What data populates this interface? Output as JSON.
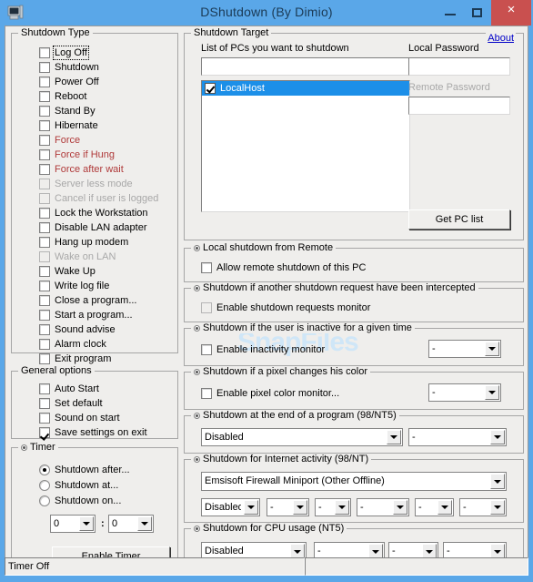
{
  "window": {
    "title": "DShutdown (By Dimio)",
    "icon": "computer-icon",
    "minimize_label": "–",
    "maximize_label": "□",
    "close_label": "×",
    "watermark": "SnapFiles"
  },
  "shutdown_type": {
    "caption": "Shutdown Type",
    "items": [
      {
        "label": "Log Off",
        "checked": false,
        "state": "focused"
      },
      {
        "label": "Shutdown",
        "checked": false,
        "state": "normal"
      },
      {
        "label": "Power Off",
        "checked": false,
        "state": "normal"
      },
      {
        "label": "Reboot",
        "checked": false,
        "state": "normal"
      },
      {
        "label": "Stand By",
        "checked": false,
        "state": "normal"
      },
      {
        "label": "Hibernate",
        "checked": false,
        "state": "normal"
      },
      {
        "label": "Force",
        "checked": false,
        "state": "red"
      },
      {
        "label": "Force if Hung",
        "checked": false,
        "state": "red"
      },
      {
        "label": "Force after wait",
        "checked": false,
        "state": "red"
      },
      {
        "label": "Server less mode",
        "checked": false,
        "state": "disabled"
      },
      {
        "label": "Cancel if user is logged",
        "checked": false,
        "state": "disabled"
      },
      {
        "label": "Lock the Workstation",
        "checked": false,
        "state": "normal"
      },
      {
        "label": "Disable LAN adapter",
        "checked": false,
        "state": "normal"
      },
      {
        "label": "Hang up modem",
        "checked": false,
        "state": "normal"
      },
      {
        "label": "Wake on LAN",
        "checked": false,
        "state": "disabled"
      },
      {
        "label": "Wake Up",
        "checked": false,
        "state": "normal"
      },
      {
        "label": "Write log file",
        "checked": false,
        "state": "normal"
      },
      {
        "label": "Close a program...",
        "checked": false,
        "state": "normal"
      },
      {
        "label": "Start a program...",
        "checked": false,
        "state": "normal"
      },
      {
        "label": "Sound advise",
        "checked": false,
        "state": "normal"
      },
      {
        "label": "Alarm clock",
        "checked": false,
        "state": "normal"
      },
      {
        "label": "Exit program",
        "checked": false,
        "state": "normal"
      }
    ]
  },
  "general_options": {
    "caption": "General options",
    "items": [
      {
        "label": "Auto Start",
        "checked": false
      },
      {
        "label": "Set default",
        "checked": false
      },
      {
        "label": "Sound on start",
        "checked": false
      },
      {
        "label": "Save settings on exit",
        "checked": true
      }
    ]
  },
  "timer": {
    "caption": "Timer",
    "radios": [
      {
        "label": "Shutdown after...",
        "selected": true
      },
      {
        "label": "Shutdown at...",
        "selected": false
      },
      {
        "label": "Shutdown on...",
        "selected": false
      }
    ],
    "hours_value": "0",
    "separator": ":",
    "minutes_value": "0",
    "button_label": "Enable Timer"
  },
  "shutdown_target": {
    "caption": "Shutdown Target",
    "about_label": "About",
    "pc_list_label": "List of PCs you want to shutdown",
    "pc_input_value": "",
    "pc_list": [
      {
        "label": "LocalHost",
        "checked": true,
        "selected": true
      }
    ],
    "local_password_label": "Local Password",
    "local_password_value": "",
    "remote_password_label": "Remote Password",
    "remote_password_value": "",
    "get_pc_list_label": "Get PC list"
  },
  "local_remote": {
    "caption": "Local shutdown from Remote",
    "checkbox_label": "Allow remote shutdown of this PC",
    "checked": false
  },
  "intercept": {
    "caption": "Shutdown if another shutdown request have been intercepted",
    "checkbox_label": "Enable shutdown requests monitor",
    "checked": false
  },
  "inactivity": {
    "caption": "Shutdown if the user is inactive for a given time",
    "checkbox_label": "Enable inactivity monitor",
    "checked": false,
    "combo_value": "-"
  },
  "pixel": {
    "caption": "Shutdown if a pixel changes his color",
    "checkbox_label": "Enable pixel color monitor...",
    "checked": false,
    "combo_value": "-"
  },
  "end_of_program": {
    "caption": "Shutdown at the end of a program (98/NT5)",
    "combo_main": "Disabled",
    "combo_second": "-"
  },
  "internet_activity": {
    "caption": "Shutdown for Internet activity (98/NT)",
    "adapter_combo": "Emsisoft Firewall Miniport (Other Offline)",
    "combos": [
      "Disabled",
      "-",
      "-",
      "-",
      "-",
      "-"
    ]
  },
  "cpu_usage": {
    "caption": "Shutdown for CPU usage (NT5)",
    "combos": [
      "Disabled",
      "-",
      "-",
      "-"
    ]
  },
  "statusbar": {
    "left_text": "Timer Off",
    "right_text": ""
  }
}
